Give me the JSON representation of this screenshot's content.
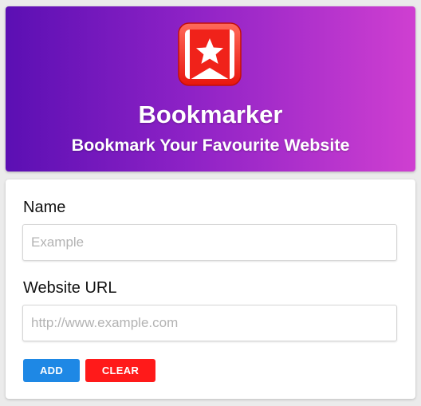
{
  "header": {
    "title": "Bookmarker",
    "subtitle": "Bookmark Your Favourite Website",
    "logo_icon": "bookmark-star-icon",
    "gradient_start": "#5b0fb3",
    "gradient_end": "#cf3fd1"
  },
  "form": {
    "name_label": "Name",
    "name_placeholder": "Example",
    "name_value": "",
    "url_label": "Website URL",
    "url_placeholder": "http://www.example.com",
    "url_value": "",
    "add_label": "ADD",
    "add_color": "#1e88e5",
    "clear_label": "CLEAR",
    "clear_color": "#ff1a1a"
  }
}
